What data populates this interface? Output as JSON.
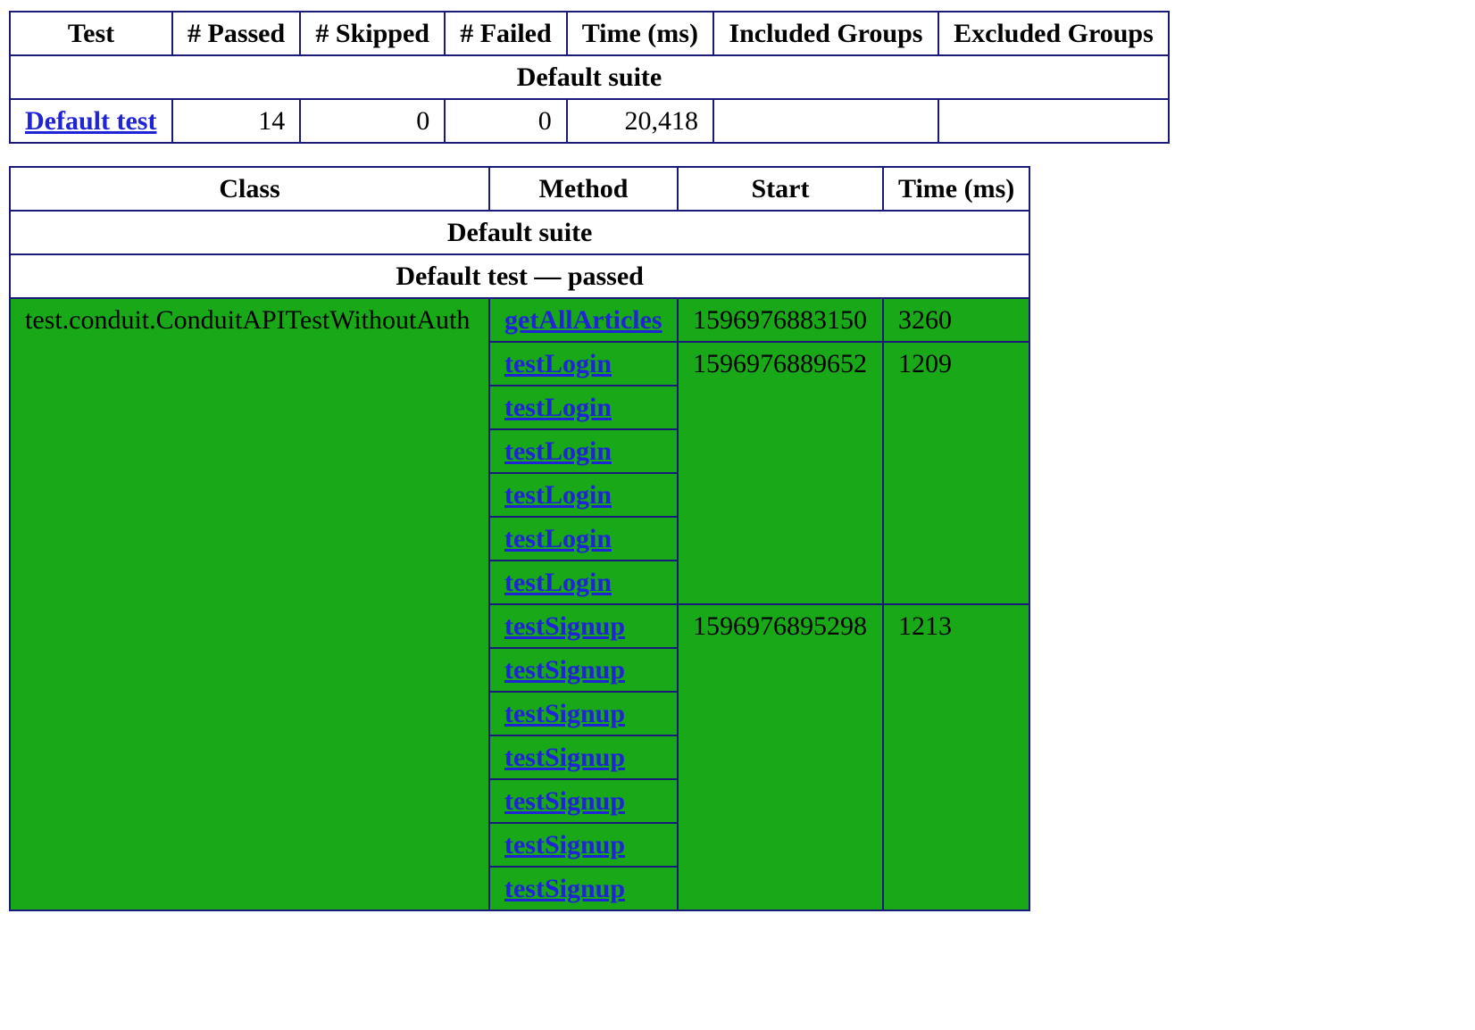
{
  "summary_table": {
    "headers": [
      "Test",
      "# Passed",
      "# Skipped",
      "# Failed",
      "Time (ms)",
      "Included Groups",
      "Excluded Groups"
    ],
    "suite_label": "Default suite",
    "row": {
      "test": "Default test",
      "passed": "14",
      "skipped": "0",
      "failed": "0",
      "time_ms": "20,418",
      "included_groups": "",
      "excluded_groups": ""
    }
  },
  "methods_table": {
    "headers": [
      "Class",
      "Method",
      "Start",
      "Time (ms)"
    ],
    "suite_label": "Default suite",
    "test_label": "Default test — passed",
    "class_name": "test.conduit.ConduitAPITestWithoutAuth",
    "groups": [
      {
        "start": "1596976883150",
        "time_ms": "3260",
        "methods": [
          "getAllArticles"
        ]
      },
      {
        "start": "1596976889652",
        "time_ms": "1209",
        "methods": [
          "testLogin",
          "testLogin",
          "testLogin",
          "testLogin",
          "testLogin",
          "testLogin"
        ]
      },
      {
        "start": "1596976895298",
        "time_ms": "1213",
        "methods": [
          "testSignup",
          "testSignup",
          "testSignup",
          "testSignup",
          "testSignup",
          "testSignup",
          "testSignup"
        ]
      }
    ]
  },
  "colors": {
    "pass_background": "#18a818",
    "border": "#1a1a7a",
    "link": "#1f24d6"
  }
}
